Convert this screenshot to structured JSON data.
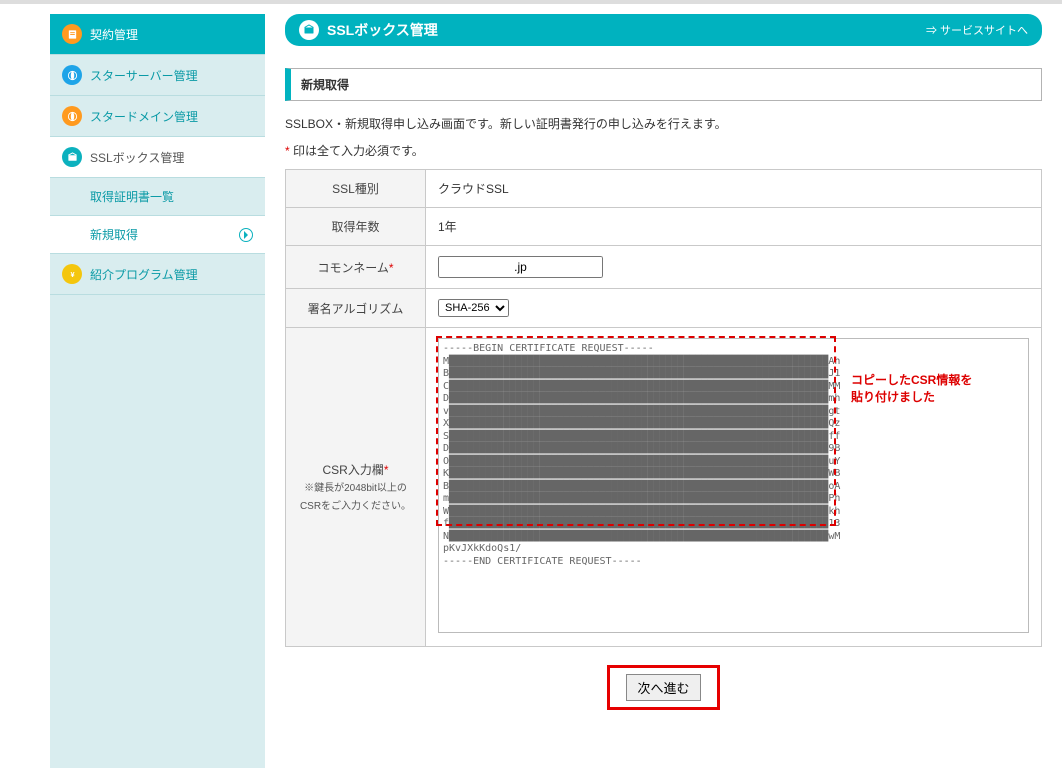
{
  "sidebar": {
    "items": [
      {
        "label": "契約管理"
      },
      {
        "label": "スターサーバー管理"
      },
      {
        "label": "スタードメイン管理"
      },
      {
        "label": "SSLボックス管理"
      },
      {
        "label": "紹介プログラム管理"
      }
    ],
    "sub": [
      {
        "label": "取得証明書一覧"
      },
      {
        "label": "新規取得"
      }
    ]
  },
  "header": {
    "title": "SSLボックス管理",
    "service_link": "⇒ サービスサイトへ"
  },
  "section": {
    "heading": "新規取得",
    "description": "SSLBOX・新規取得申し込み画面です。新しい証明書発行の申し込みを行えます。",
    "note_prefix": "*",
    "note_text": " 印は全て入力必須です。"
  },
  "form": {
    "rows": {
      "ssl_type": {
        "label": "SSL種別",
        "value": "クラウドSSL"
      },
      "years": {
        "label": "取得年数",
        "value": "1年"
      },
      "cn": {
        "label": "コモンネーム",
        "value": ".jp"
      },
      "algo": {
        "label": "署名アルゴリズム",
        "selected": "SHA-256"
      },
      "csr": {
        "label": "CSR入力欄",
        "sub1": "※鍵長が2048bit以上の",
        "sub2": "CSRをご入力ください。",
        "value": "-----BEGIN CERTIFICATE REQUEST-----\nM███████████████████████████████████████████████████████████████Ah\nB███████████████████████████████████████████████████████████████J1\nC███████████████████████████████████████████████████████████████MM\nD███████████████████████████████████████████████████████████████mh\nv███████████████████████████████████████████████████████████████gt\nX███████████████████████████████████████████████████████████████Qz\nS███████████████████████████████████████████████████████████████ff\nD███████████████████████████████████████████████████████████████9B\nO███████████████████████████████████████████████████████████████uY\nK███████████████████████████████████████████████████████████████WB\nB███████████████████████████████████████████████████████████████oA\nm███████████████████████████████████████████████████████████████Ph\nW███████████████████████████████████████████████████████████████kh\nf███████████████████████████████████████████████████████████████13\nN███████████████████████████████████████████████████████████████wM\npKvJXkKdoQs1/\n-----END CERTIFICATE REQUEST-----"
      }
    },
    "algo_options": [
      "SHA-256"
    ]
  },
  "annotations": {
    "csr_pasted_l1": "コピーしたCSR情報を",
    "csr_pasted_l2": "貼り付けました"
  },
  "buttons": {
    "next": "次へ進む"
  }
}
